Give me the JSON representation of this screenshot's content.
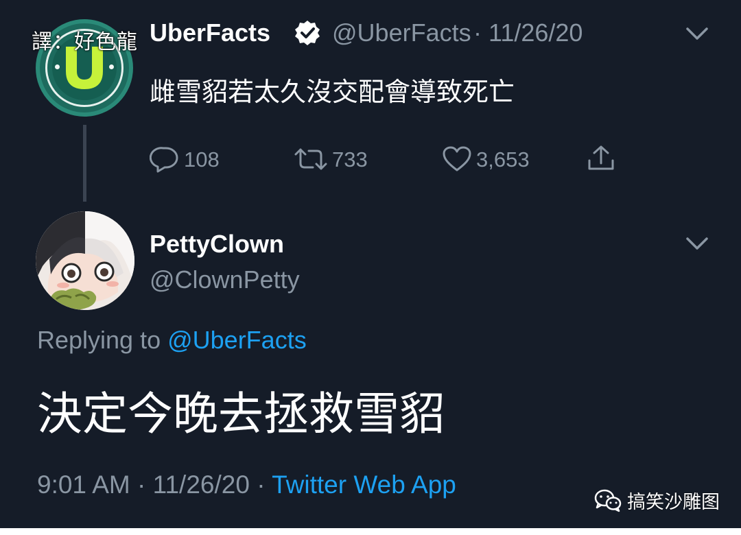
{
  "watermark": {
    "translator": "譯：好色龍"
  },
  "original_tweet": {
    "author_name": "UberFacts",
    "handle": "@UberFacts",
    "date": "· 11/26/20",
    "text": "雌雪貂若太久沒交配會導致死亡",
    "replies": "108",
    "retweets": "733",
    "likes": "3,653"
  },
  "reply_tweet": {
    "author_name": "PettyClown",
    "handle": "@ClownPetty",
    "replying_prefix": "Replying to ",
    "replying_to": "@UberFacts",
    "text": "決定今晚去拯救雪貂",
    "time": "9:01 AM · 11/26/20 · ",
    "source": "Twitter Web App"
  },
  "footer": {
    "wechat_account": "搞笑沙雕图"
  },
  "colors": {
    "background": "#151c28",
    "primary_text": "#ffffff",
    "secondary_text": "#8a96a3",
    "link": "#1da1f2"
  },
  "icons": [
    "reply-icon",
    "retweet-icon",
    "like-icon",
    "share-icon",
    "verified-badge-icon",
    "chevron-down-icon",
    "wechat-icon"
  ]
}
